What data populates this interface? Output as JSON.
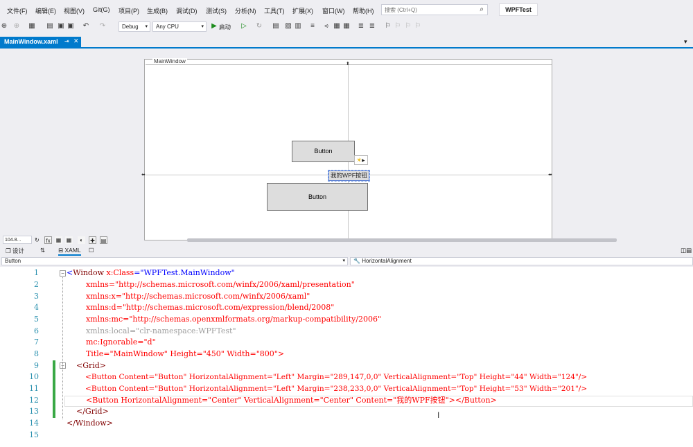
{
  "menu": [
    "文件(F)",
    "编辑(E)",
    "视图(V)",
    "Git(G)",
    "项目(P)",
    "生成(B)",
    "调试(D)",
    "测试(S)",
    "分析(N)",
    "工具(T)",
    "扩展(X)",
    "窗口(W)",
    "帮助(H)"
  ],
  "search": {
    "placeholder": "搜索 (Ctrl+Q)"
  },
  "solution_name": "WPFTest",
  "toolbar": {
    "config": "Debug",
    "platform": "Any CPU",
    "start_label": "启动"
  },
  "tab": {
    "label": "MainWindow.xaml"
  },
  "designer": {
    "window_title": "MainWindow",
    "button1": "Button",
    "button2": "Button",
    "button3": "我的WPF按钮",
    "zoom": "104.8..."
  },
  "view_tabs": {
    "design": "设计",
    "xaml": "XAML"
  },
  "nav": {
    "element": "Button",
    "property": "HorizontalAlignment"
  },
  "line_numbers": [
    "1",
    "2",
    "3",
    "4",
    "5",
    "6",
    "7",
    "8",
    "9",
    "10",
    "11",
    "12",
    "13",
    "14",
    "15"
  ],
  "code": {
    "l1a": "<",
    "l1b": "Window",
    "l1c": " x:Class",
    "l1d": "=\"",
    "l1e": "WPFTest.MainWindow",
    "l1f": "\"",
    "l2": "        xmlns=\"http://schemas.microsoft.com/winfx/2006/xaml/presentation\"",
    "l3": "        xmlns:x=\"http://schemas.microsoft.com/winfx/2006/xaml\"",
    "l4": "        xmlns:d=\"http://schemas.microsoft.com/expression/blend/2008\"",
    "l5": "        xmlns:mc=\"http://schemas.openxmlformats.org/markup-compatibility/2006\"",
    "l6": "        xmlns:local=\"clr-namespace:WPFTest\"",
    "l7": "        mc:Ignorable=\"d\"",
    "l8": "        Title=\"MainWindow\" Height=\"450\" Width=\"800\">",
    "l9": "    <Grid>",
    "l10": "        <Button Content=\"Button\" HorizontalAlignment=\"Left\" Margin=\"289,147,0,0\" VerticalAlignment=\"Top\" Height=\"44\" Width=\"124\"/>",
    "l11": "        <Button Content=\"Button\" HorizontalAlignment=\"Left\" Margin=\"238,233,0,0\" VerticalAlignment=\"Top\" Height=\"53\" Width=\"201\"/>",
    "l12": "        <Button HorizontalAlignment=\"Center\" VerticalAlignment=\"Center\" Content=\"我的WPF按钮\"></Button>",
    "l13": "    </Grid>",
    "l14": "</Window>",
    "l15": ""
  }
}
